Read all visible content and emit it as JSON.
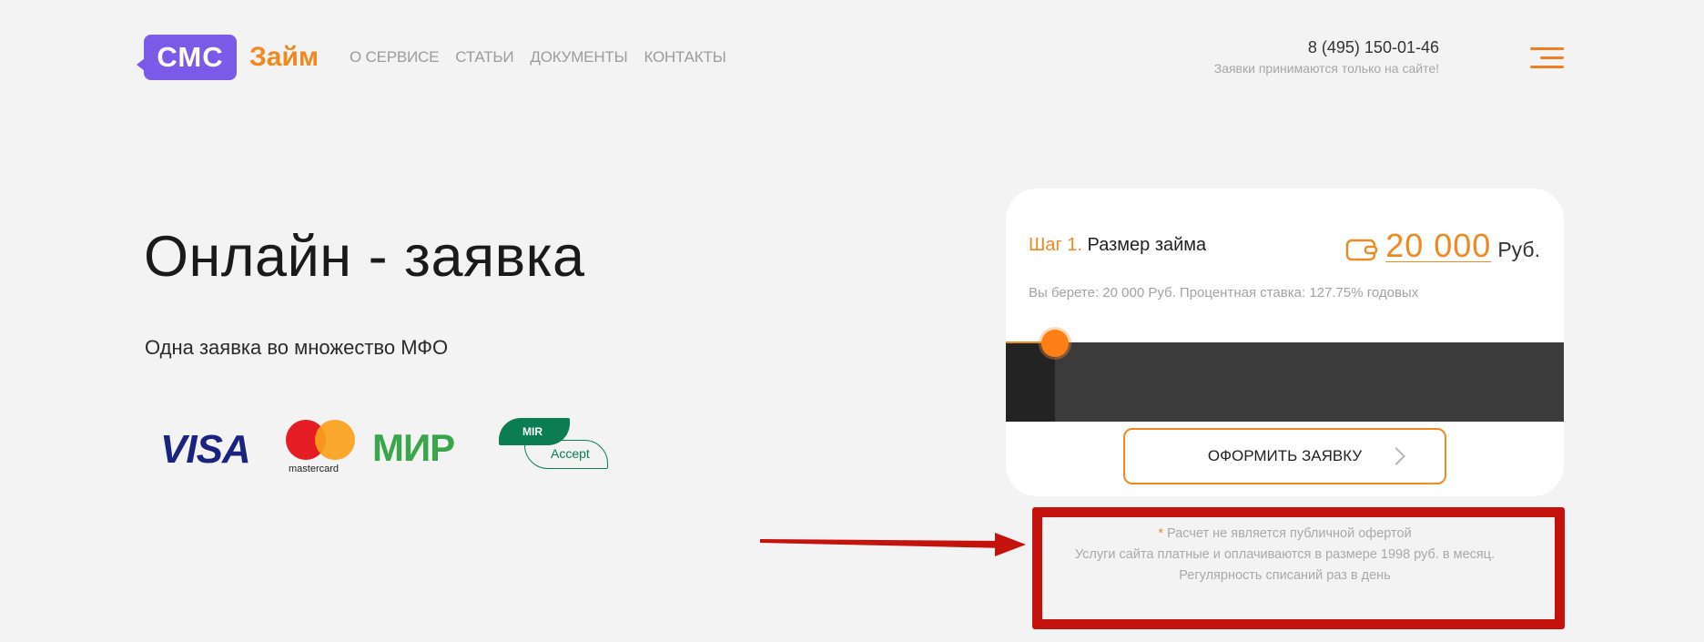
{
  "header": {
    "logo": {
      "badge": "СМС",
      "word": "Займ"
    },
    "nav": [
      "О СЕРВИСЕ",
      "СТАТЬИ",
      "ДОКУМЕНТЫ",
      "КОНТАКТЫ"
    ],
    "phone": "8 (495) 150-01-46",
    "phone_note": "Заявки принимаются только на сайте!",
    "menu_icon": "hamburger-icon"
  },
  "hero": {
    "title": "Онлайн - заявка",
    "subtitle": "Одна заявка во множество МФО",
    "payments": {
      "visa": "VISA",
      "mastercard": "mastercard",
      "mir": "МИР",
      "mir_accept_top": "MIR",
      "mir_accept_bottom": "Accept"
    }
  },
  "card": {
    "step_num": "Шаг 1.",
    "step_label": "Размер займа",
    "amount": "20 000",
    "currency": "Руб.",
    "calc_text": "Вы берете: 20 000 Руб. Процентная ставка: 127.75% годовых",
    "slider_value": 20000,
    "apply_button": "ОФОРМИТЬ ЗАЯВКУ"
  },
  "disclaimer": {
    "star": "*",
    "line1": "Расчет не является публичной офертой",
    "line2": "Услуги сайта платные и оплачиваются в размере 1998 руб. в месяц.",
    "line3": "Регулярность списаний раз в день"
  },
  "colors": {
    "accent": "#ef8a22",
    "logo_purple": "#7a5ae6",
    "annotation_red": "#c4130d",
    "background": "#f4f3f4"
  }
}
